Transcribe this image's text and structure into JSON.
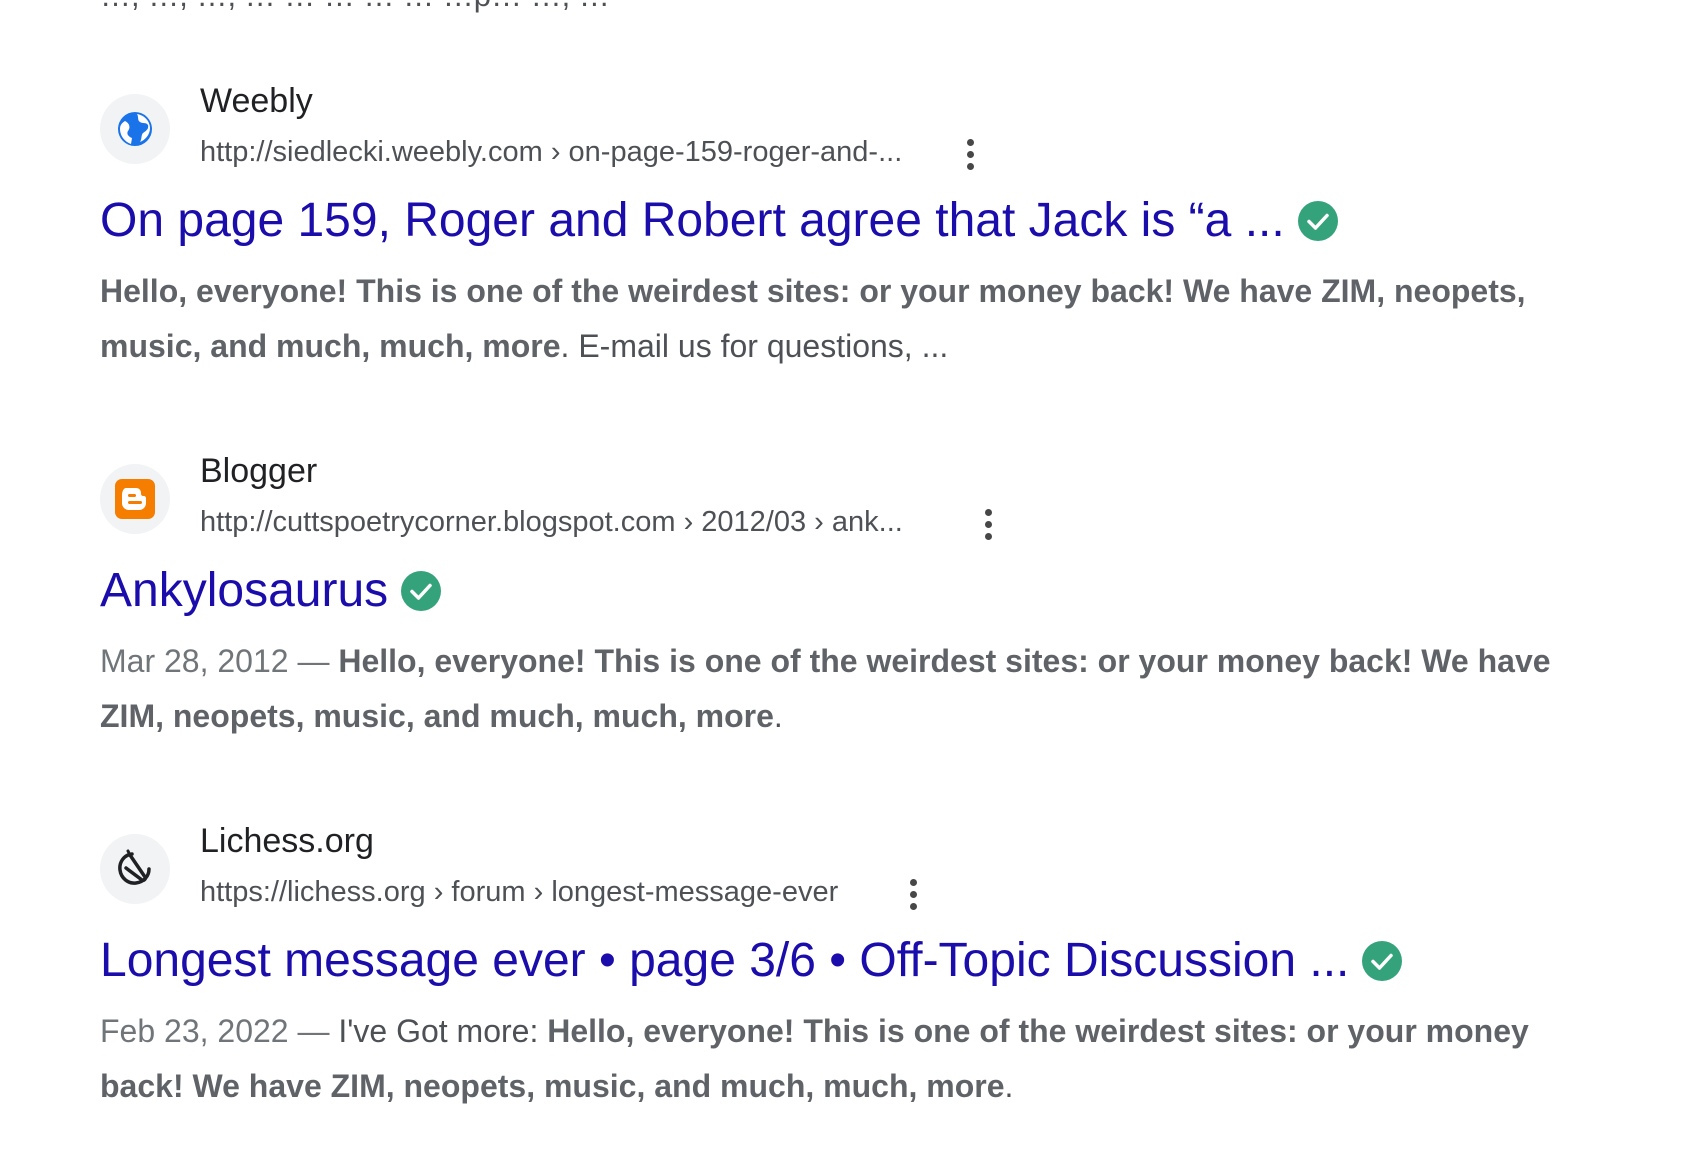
{
  "clipped_top_text": "…, …, …, … … … … … …p… …, …",
  "results": [
    {
      "site_name": "Weebly",
      "url": "http://siedlecki.weebly.com › on-page-159-roger-and-...",
      "favicon": "globe-icon",
      "title": "On page 159, Roger and Robert agree that Jack is “a ...",
      "date": "",
      "snippet_prefix": "",
      "snippet_bold": "Hello, everyone! This is one of the weirdest sites: or your money back! We have ZIM, neopets, music, and much, much, more",
      "snippet_suffix": ". E-mail us for questions, ..."
    },
    {
      "site_name": "Blogger",
      "url": "http://cuttspoetrycorner.blogspot.com › 2012/03 › ank...",
      "favicon": "blogger-icon",
      "title": "Ankylosaurus",
      "date": "Mar 28, 2012 —",
      "snippet_prefix": "",
      "snippet_bold": "Hello, everyone! This is one of the weirdest sites: or your money back! We have ZIM, neopets, music, and much, much, more",
      "snippet_suffix": "."
    },
    {
      "site_name": "Lichess.org",
      "url": "https://lichess.org › forum › longest-message-ever",
      "favicon": "lichess-icon",
      "title": "Longest message ever • page 3/6 • Off-Topic Discussion ...",
      "date": "Feb 23, 2022 —",
      "snippet_prefix": "I've Got more:",
      "snippet_bold": "Hello, everyone! This is one of the weirdest sites: or your money back! We have ZIM, neopets, music, and much, much, more",
      "snippet_suffix": "."
    }
  ],
  "colors": {
    "title_link": "#1a0dab",
    "verified_badge": "#34a37b",
    "blogger_orange": "#f57d00",
    "globe_blue": "#1a73e8"
  }
}
